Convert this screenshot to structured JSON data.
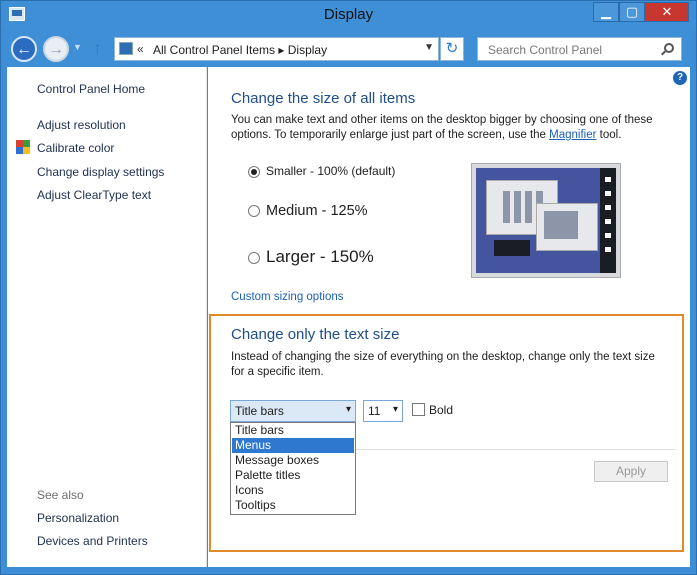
{
  "window": {
    "title": "Display",
    "minimize": "▁",
    "maximize": "▢",
    "close": "✕"
  },
  "nav": {
    "back": "←",
    "forward": "→",
    "up": "↑",
    "address_chevron": "«",
    "address_path": "All Control Panel Items  ▸  Display",
    "refresh": "↻",
    "search_placeholder": "Search Control Panel"
  },
  "sidebar": {
    "home": "Control Panel Home",
    "items": [
      "Adjust resolution",
      "Calibrate color",
      "Change display settings",
      "Adjust ClearType text"
    ],
    "see_also_label": "See also",
    "see_also": [
      "Personalization",
      "Devices and Printers"
    ]
  },
  "main": {
    "help": "?",
    "size_heading": "Change the size of all items",
    "size_desc_1": "You can make text and other items on the desktop bigger by choosing one of these",
    "size_desc_2_pre": "options. To temporarily enlarge just part of the screen, use the ",
    "size_desc_link": "Magnifier",
    "size_desc_2_post": " tool.",
    "options": [
      {
        "label": "Smaller - 100% (default)",
        "checked": true
      },
      {
        "label": "Medium - 125%",
        "checked": false
      },
      {
        "label": "Larger - 150%",
        "checked": false
      }
    ],
    "custom_link": "Custom sizing options",
    "text_heading": "Change only the text size",
    "text_desc_1": "Instead of changing the size of everything on the desktop, change only the text size",
    "text_desc_2": "for a specific item.",
    "item_select": "Title bars",
    "size_select": "11",
    "bold_label": "Bold",
    "dropdown_items": [
      "Title bars",
      "Menus",
      "Message boxes",
      "Palette titles",
      "Icons",
      "Tooltips"
    ],
    "dropdown_selected": "Menus",
    "apply": "Apply"
  }
}
